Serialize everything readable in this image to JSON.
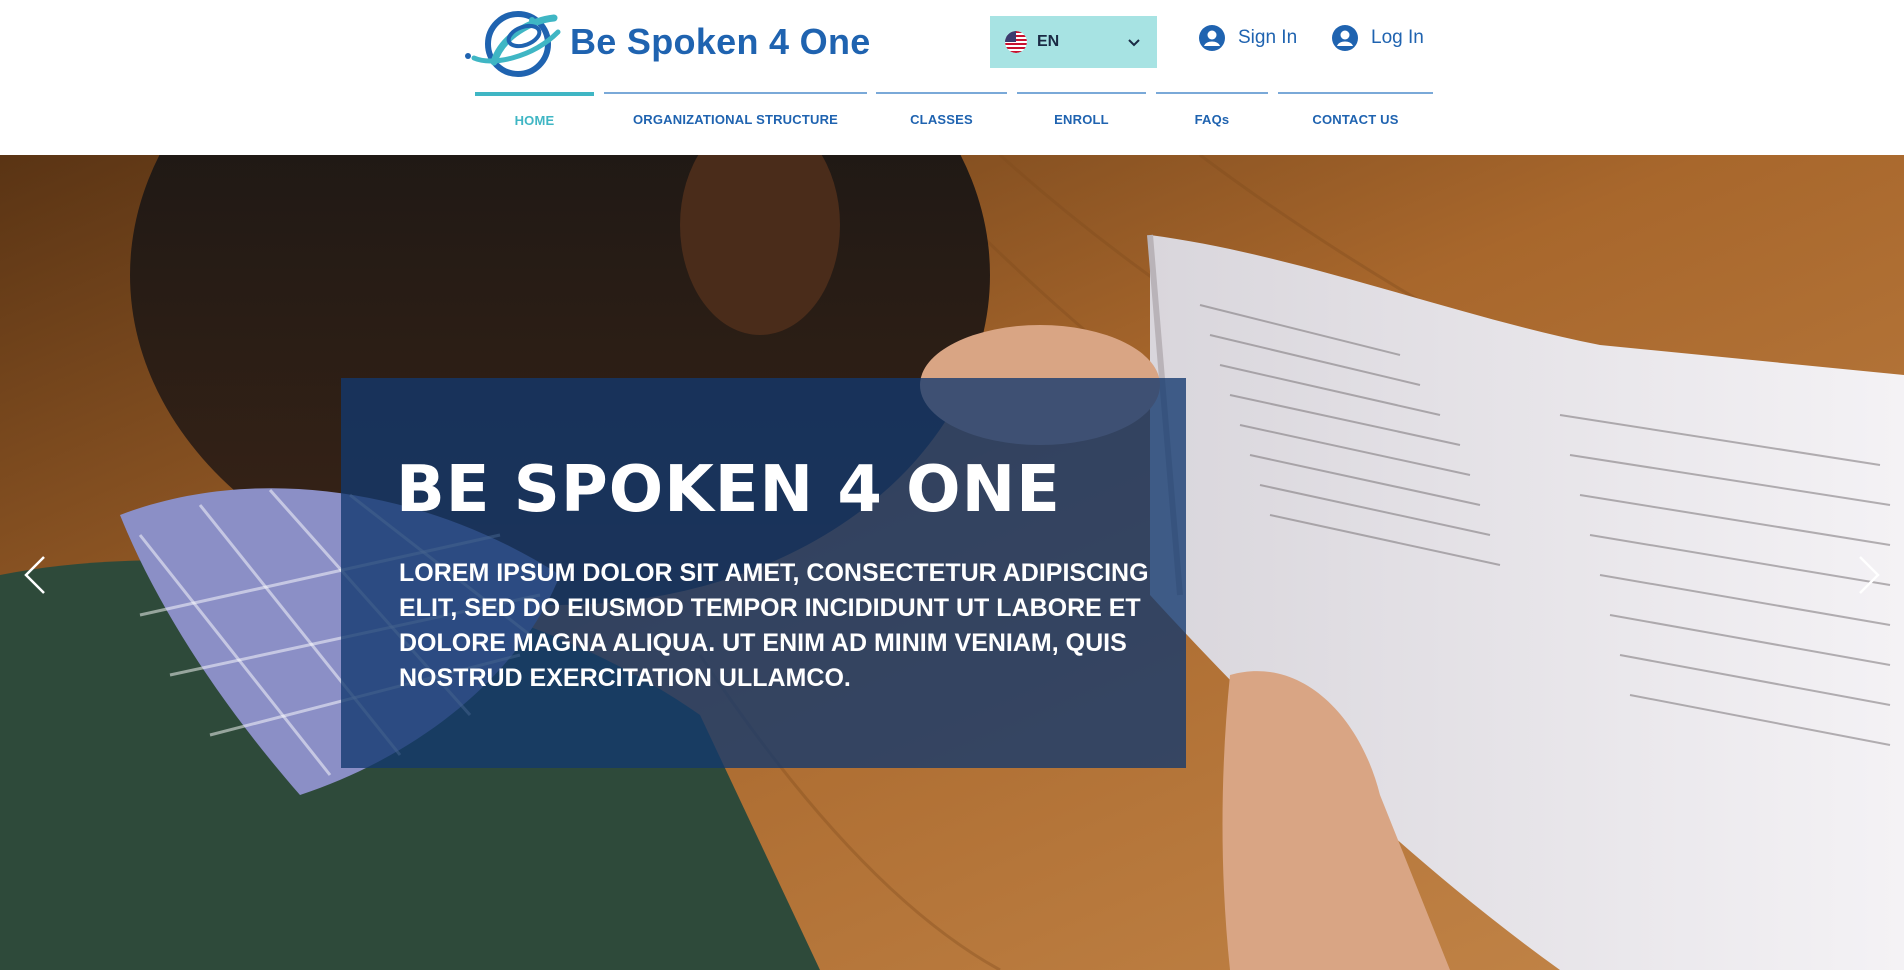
{
  "brand": {
    "name": "Be Spoken 4 One",
    "colors": {
      "primary": "#1f63b0",
      "accent": "#3fb6c4",
      "lang_bg": "#a7e3e3"
    }
  },
  "language": {
    "selected": "EN",
    "flag_icon": "us-flag-icon"
  },
  "auth": {
    "sign_in": "Sign In",
    "log_in": "Log In"
  },
  "nav": {
    "items": [
      {
        "label": "HOME",
        "active": true
      },
      {
        "label": "ORGANIZATIONAL STRUCTURE"
      },
      {
        "label": "CLASSES"
      },
      {
        "label": "ENROLL"
      },
      {
        "label": "FAQs"
      },
      {
        "label": "CONTACT US"
      }
    ]
  },
  "hero": {
    "title": "BE SPOKEN 4 ONE",
    "body": "LOREM IPSUM DOLOR SIT AMET, CONSECTETUR ADIPISCING ELIT, SED DO EIUSMOD TEMPOR INCIDIDUNT UT LABORE ET DOLORE MAGNA ALIQUA. UT ENIM AD MINIM VENIAM, QUIS NOSTRUD EXERCITATION ULLAMCO."
  }
}
